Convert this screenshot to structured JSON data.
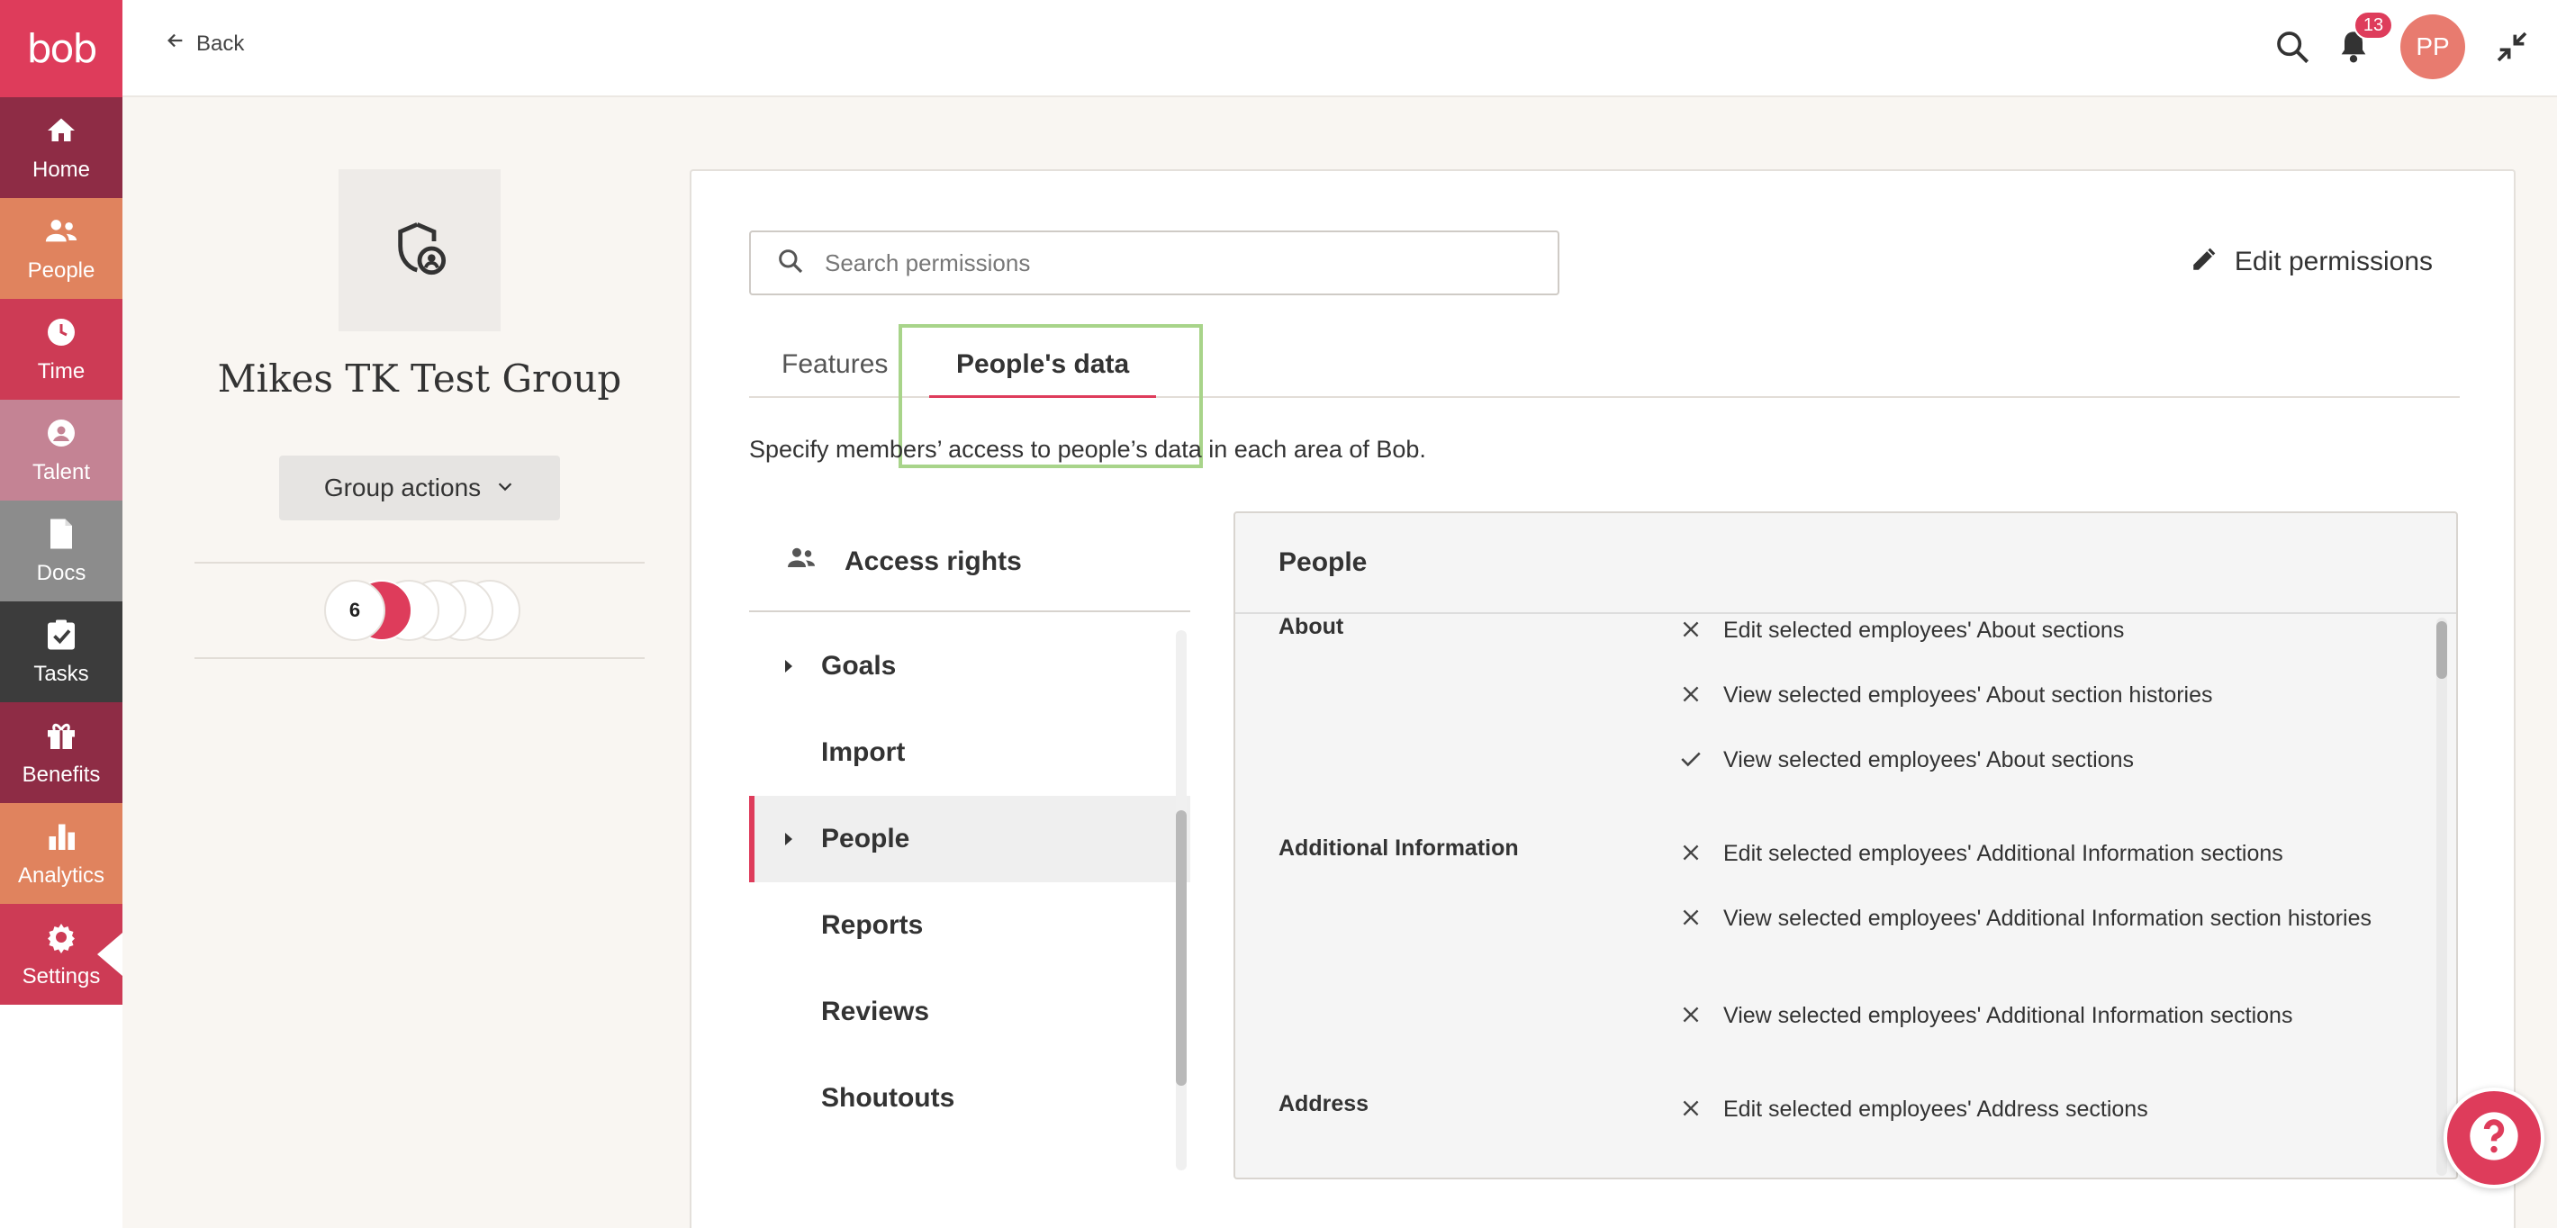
{
  "brand": {
    "logo_text": "bob",
    "accent": "#de3c5b"
  },
  "nav": {
    "items": [
      {
        "label": "Home",
        "icon": "home-icon",
        "color": "#8e2c45"
      },
      {
        "label": "People",
        "icon": "people-icon",
        "color": "#e0835e"
      },
      {
        "label": "Time",
        "icon": "clock-icon",
        "color": "#cd3b55"
      },
      {
        "label": "Talent",
        "icon": "talent-icon",
        "color": "#c48394"
      },
      {
        "label": "Docs",
        "icon": "doc-icon",
        "color": "#8c8c8c"
      },
      {
        "label": "Tasks",
        "icon": "tasks-icon",
        "color": "#3c3c3c"
      },
      {
        "label": "Benefits",
        "icon": "gift-icon",
        "color": "#8e2c45"
      },
      {
        "label": "Analytics",
        "icon": "bar-chart-icon",
        "color": "#e0835e"
      },
      {
        "label": "Settings",
        "icon": "gear-icon",
        "color": "#cd3b55"
      }
    ]
  },
  "topbar": {
    "back_label": "Back",
    "notification_count": "13",
    "avatar_initials": "PP"
  },
  "group": {
    "name": "Mikes TK Test Group",
    "actions_label": "Group actions",
    "member_count": "6"
  },
  "permissions": {
    "search_placeholder": "Search permissions",
    "edit_label": "Edit permissions",
    "tabs": [
      {
        "label": "Features",
        "active": false
      },
      {
        "label": "People's data",
        "active": true
      }
    ],
    "description": "Specify members’ access to people’s data in each area of Bob.",
    "access_rights_label": "Access rights",
    "categories": [
      {
        "label": "Goals",
        "expandable": true,
        "active": false
      },
      {
        "label": "Import",
        "expandable": false,
        "active": false
      },
      {
        "label": "People",
        "expandable": true,
        "active": true
      },
      {
        "label": "Reports",
        "expandable": false,
        "active": false
      },
      {
        "label": "Reviews",
        "expandable": false,
        "active": false
      },
      {
        "label": "Shoutouts",
        "expandable": false,
        "active": false
      }
    ],
    "detail": {
      "title": "People",
      "sections": [
        {
          "title": "About",
          "items": [
            {
              "text": "Edit selected employees' About sections",
              "granted": false
            },
            {
              "text": "View selected employees' About section histories",
              "granted": false
            },
            {
              "text": "View selected employees' About sections",
              "granted": true
            }
          ]
        },
        {
          "title": "Additional Information",
          "items": [
            {
              "text": "Edit selected employees' Additional Information sections",
              "granted": false
            },
            {
              "text": "View selected employees' Additional Information section histories",
              "granted": false
            },
            {
              "text": "View selected employees' Additional Information sections",
              "granted": false
            }
          ]
        },
        {
          "title": "Address",
          "items": [
            {
              "text": "Edit selected employees' Address sections",
              "granted": false
            }
          ]
        }
      ]
    }
  }
}
